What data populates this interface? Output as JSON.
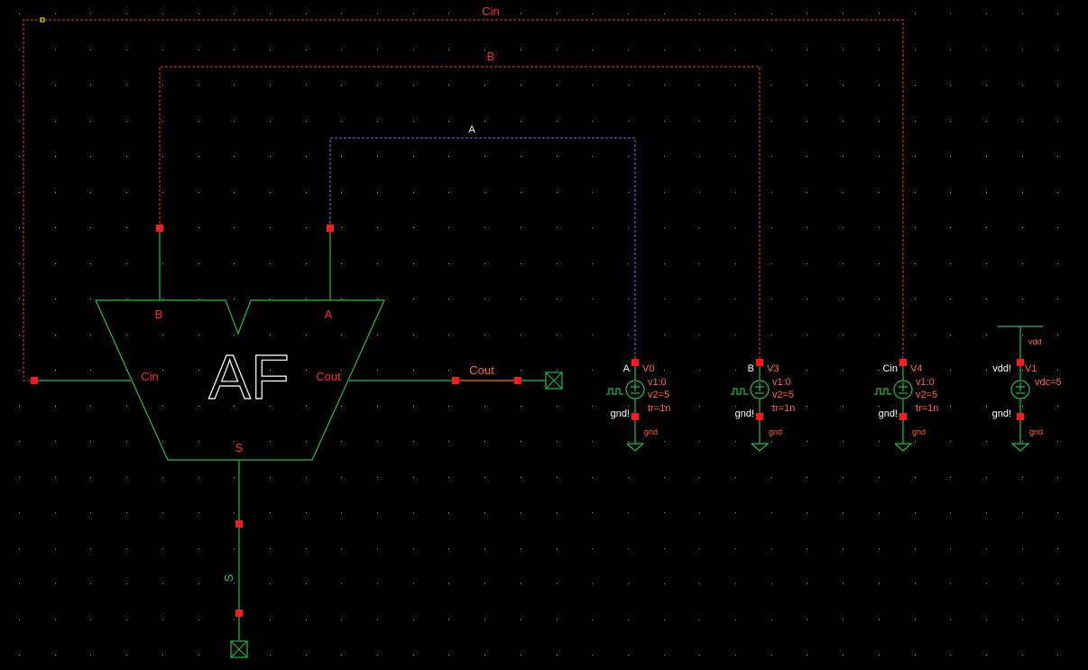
{
  "canvas": {
    "background": "#000000",
    "grid_color": "#8a8a8a"
  },
  "colors": {
    "symbol": "#20c040",
    "wire_red": "#ff3030",
    "wire_blue": "#7070ff",
    "pin": "#ff1a1a",
    "prop": "#ff6a2a"
  },
  "nets": {
    "cin": "Cin",
    "b": "B",
    "a": "A",
    "cout": "Cout",
    "s": "S"
  },
  "adder": {
    "name": "AF",
    "pins": {
      "b": "B",
      "a": "A",
      "cin": "Cin",
      "cout": "Cout",
      "s": "S"
    }
  },
  "sources": [
    {
      "net": "A",
      "inst": "V0",
      "p1": "v1:0",
      "p2": "v2=5",
      "p3": "tr=1n",
      "gnd_pin": "gnd!",
      "gnd_label": "gnd"
    },
    {
      "net": "B",
      "inst": "V3",
      "p1": "v1:0",
      "p2": "v2=5",
      "p3": "tr=1n",
      "gnd_pin": "gnd!",
      "gnd_label": "gnd"
    },
    {
      "net": "Cin",
      "inst": "V4",
      "p1": "v1:0",
      "p2": "v2=5",
      "p3": "tr=1n",
      "gnd_pin": "gnd!",
      "gnd_label": "gnd"
    }
  ],
  "dc_source": {
    "top_label": "vdd",
    "top_pin": "vdd!",
    "inst": "V1",
    "value": "vdc=5",
    "gnd_pin": "gnd!",
    "gnd_label": "gnd"
  }
}
